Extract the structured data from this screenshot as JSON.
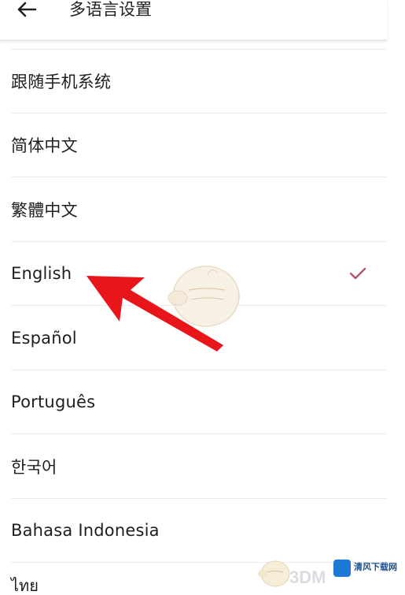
{
  "header": {
    "title": "多语言设置",
    "back_icon": "arrow-left-icon"
  },
  "languages": [
    {
      "label": "跟随手机系统",
      "selected": false
    },
    {
      "label": "简体中文",
      "selected": false
    },
    {
      "label": "繁體中文",
      "selected": false
    },
    {
      "label": "English",
      "selected": true
    },
    {
      "label": "Español",
      "selected": false
    },
    {
      "label": "Português",
      "selected": false
    },
    {
      "label": "한국어",
      "selected": false
    },
    {
      "label": "Bahasa Indonesia",
      "selected": false
    }
  ],
  "partial_item": {
    "label": "ไทย"
  },
  "selected_icon": "checkmark-icon",
  "colors": {
    "check": "#b2546b",
    "arrow": "#e8151a",
    "divider": "#ececec"
  },
  "watermark": {
    "logo_text": "3DM",
    "site_name": "清风下载网"
  }
}
